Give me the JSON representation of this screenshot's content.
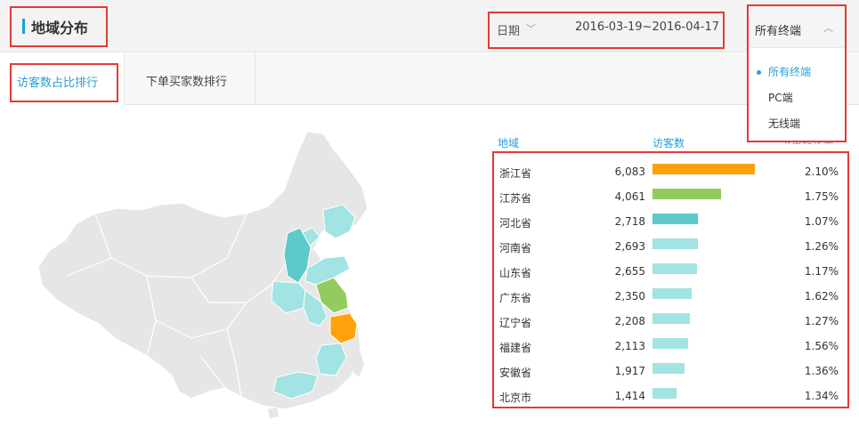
{
  "header": {
    "title": "地域分布"
  },
  "date_filter": {
    "label": "日期",
    "range": "2016-03-19~2016-04-17"
  },
  "tabs": [
    {
      "label": "访客数占比排行",
      "active": true
    },
    {
      "label": "下单买家数排行",
      "active": false
    }
  ],
  "terminal_dropdown": {
    "selected": "所有终端",
    "options": [
      "所有终端",
      "PC端",
      "无线端"
    ]
  },
  "table": {
    "columns": [
      "地域",
      "访客数",
      "下单转化率"
    ],
    "rows": [
      {
        "region": "浙江省",
        "visitors": "6,083",
        "rate": "2.10%",
        "bar_fraction": 1.0,
        "color": "#ffa20c"
      },
      {
        "region": "江苏省",
        "visitors": "4,061",
        "rate": "1.75%",
        "bar_fraction": 0.668,
        "color": "#93cc5e"
      },
      {
        "region": "河北省",
        "visitors": "2,718",
        "rate": "1.07%",
        "bar_fraction": 0.447,
        "color": "#5ec9c9"
      },
      {
        "region": "河南省",
        "visitors": "2,693",
        "rate": "1.26%",
        "bar_fraction": 0.443,
        "color": "#a2e3e3"
      },
      {
        "region": "山东省",
        "visitors": "2,655",
        "rate": "1.17%",
        "bar_fraction": 0.436,
        "color": "#a2e3e3"
      },
      {
        "region": "广东省",
        "visitors": "2,350",
        "rate": "1.62%",
        "bar_fraction": 0.386,
        "color": "#a2e3e3"
      },
      {
        "region": "辽宁省",
        "visitors": "2,208",
        "rate": "1.27%",
        "bar_fraction": 0.363,
        "color": "#a2e3e3"
      },
      {
        "region": "福建省",
        "visitors": "2,113",
        "rate": "1.56%",
        "bar_fraction": 0.347,
        "color": "#a2e3e3"
      },
      {
        "region": "安徽省",
        "visitors": "1,917",
        "rate": "1.36%",
        "bar_fraction": 0.315,
        "color": "#a2e3e3"
      },
      {
        "region": "北京市",
        "visitors": "1,414",
        "rate": "1.34%",
        "bar_fraction": 0.232,
        "color": "#a2e3e3"
      }
    ]
  },
  "colors": {
    "accent": "#2a9fd6",
    "highlight_border": "#e53935",
    "map_base": "#e6e6e6",
    "map_rank1": "#ffa20c",
    "map_rank2": "#93cc5e",
    "map_rank3": "#5ec9c9",
    "map_rank_other": "#a2e3e3"
  },
  "icons": {
    "date_chevron": "chevron-down-icon",
    "dropdown_chevron": "chevron-up-icon"
  }
}
